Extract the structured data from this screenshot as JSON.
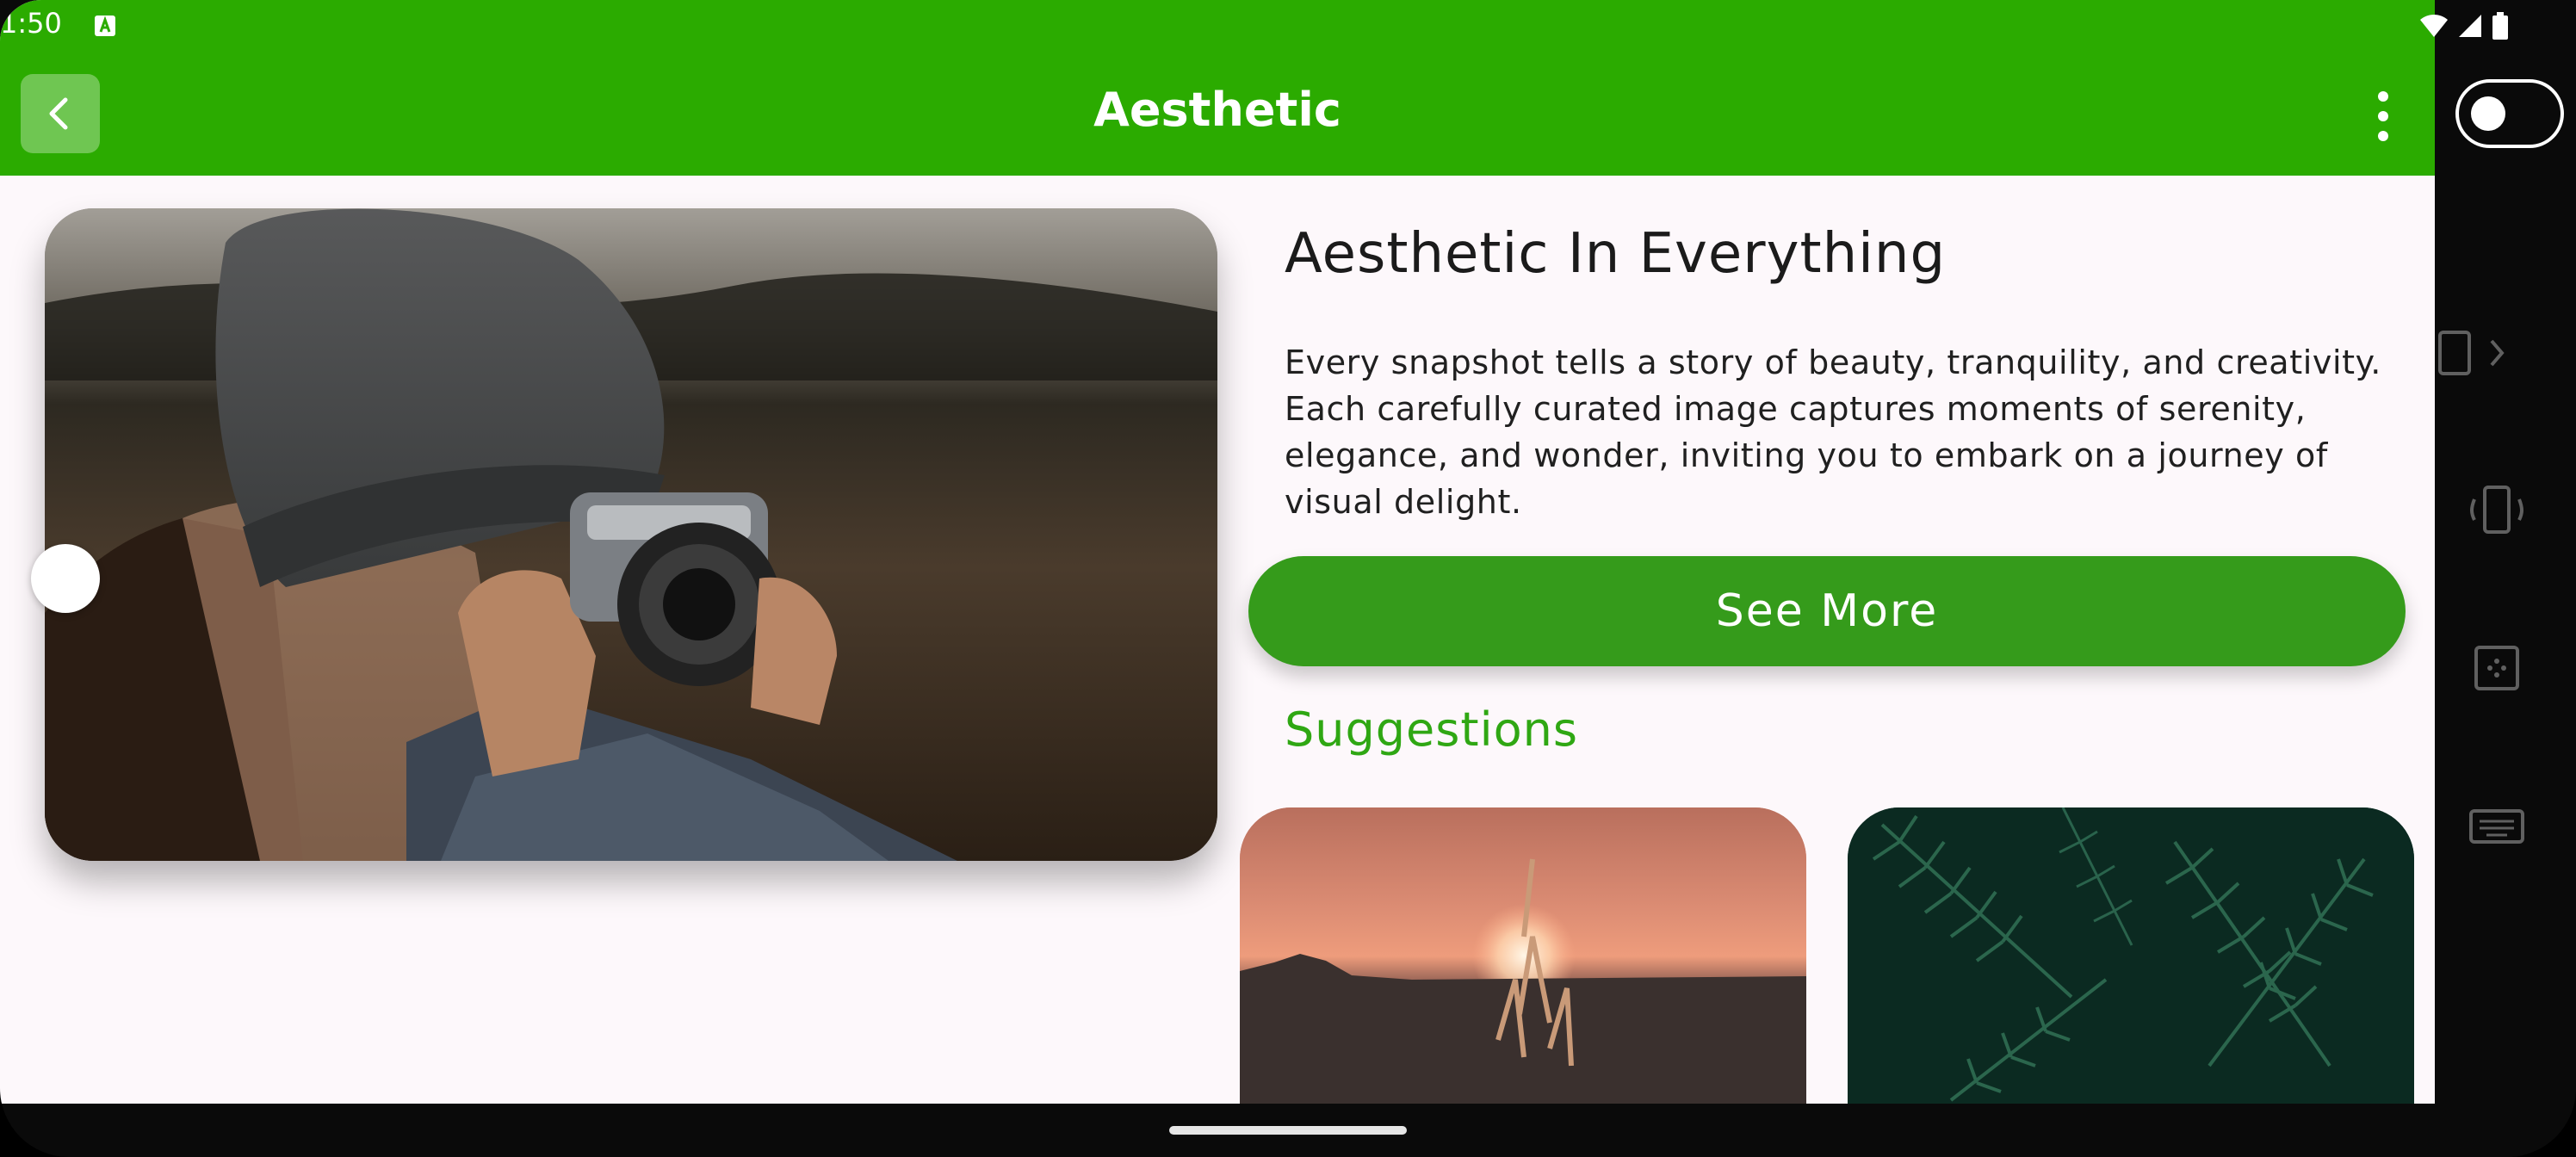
{
  "status_bar": {
    "time": "1:50"
  },
  "app_bar": {
    "title": "Aesthetic"
  },
  "content": {
    "heading": "Aesthetic In Everything",
    "description": "Every snapshot tells a story of beauty, tranquility, and creativity. Each carefully curated image captures moments of serenity, elegance, and wonder, inviting you to embark on a journey of visual delight.",
    "see_more_label": "See More",
    "suggestions_title": "Suggestions"
  },
  "colors": {
    "app_bar": "#2bab00",
    "button": "#359b1b",
    "accent_text": "#2fa713",
    "background": "#fdf8fb"
  },
  "icons": [
    "back-arrow-icon",
    "more-vert-icon",
    "toggle-icon",
    "wifi-icon",
    "signal-icon",
    "battery-icon",
    "tablet-icon",
    "rotate-icon",
    "screenshot-icon",
    "keyboard-icon"
  ]
}
